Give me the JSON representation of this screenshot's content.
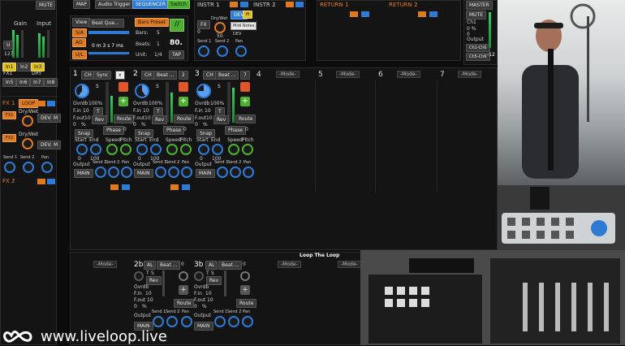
{
  "left": {
    "mute": "MUTE",
    "gain": "Gain",
    "input": "Input",
    "u": "U",
    "num127": "127",
    "inputs_row1": [
      "In1",
      "In2",
      "In3"
    ],
    "fx1": "FX1",
    "dry": "DRY",
    "inputs_row2": [
      "In5",
      "In6",
      "In7",
      "In8"
    ],
    "fx_section": "FX 1",
    "loop_badge": "LOOP",
    "dryw": "Dry/Wet",
    "dev": "DEV",
    "m": "M",
    "fx_section2": "FX 2",
    "send1": "Send 1",
    "send2": "Send 2",
    "pan": "Pan"
  },
  "top": {
    "tabs": [
      "MAP",
      "Audio Trigger",
      "SEQUENCER",
      "Switch"
    ],
    "view": "View",
    "beat_quant": "Beat Qua...",
    "bars_preset": "Bars Preset",
    "sa": "S/A",
    "ad": "AD",
    "ul": "U/L",
    "bars_label": "Bars:",
    "bars_val": "5",
    "beats_label": "Beats:",
    "beats_val": "1",
    "unit_label": "Unit:",
    "unit_val": "1/4",
    "time": "0 m 3 s 7 ms",
    "tempo": "80.",
    "tap": "TAP",
    "fx_glyph": "//"
  },
  "instr": {
    "instr1": "INSTR 1",
    "instr2": "INSTR 2",
    "dev": "DEV",
    "tooltip": "Midi Notes",
    "fx": "FX",
    "dry": "Dry/Wet",
    "dev2": "DEV",
    "fifty": "50",
    "zero": "0",
    "send1": "Send 1",
    "send2": "Send 2",
    "pan": "Pan"
  },
  "returns": {
    "r1": "RETURN 1",
    "r2": "RETURN 2"
  },
  "master": {
    "master": "MASTER",
    "mute": "MUTE",
    "ch": "Ch1",
    "pct": "0 %",
    "zero": "0",
    "output": "Output",
    "chout1": "Ch1-Ch6",
    "chout2": "Ch5-Ch6",
    "db": "-12"
  },
  "tracks": [
    {
      "num": "1",
      "ch": "CH",
      "name": "Sync",
      "x": "x"
    },
    {
      "num": "2",
      "ch": "CH",
      "name": "Beat ...",
      "x": "2"
    },
    {
      "num": "3",
      "ch": "CH",
      "name": "Beat ...",
      "x": "7"
    }
  ],
  "track_common": {
    "ovrdb": "Ovrdb",
    "pct100": "100%",
    "fin": "F.in",
    "fout": "F.out",
    "v10": "10",
    "v0": "0",
    "pct": "%",
    "t": "T",
    "rev": "Rev",
    "s": "S",
    "route": "Route",
    "snap": "Snap",
    "phase": "Phase",
    "start": "Start",
    "end": "End",
    "speed": "Speed",
    "pitch": "Pitch",
    "v100": "100",
    "output": "Output",
    "main": "MAIN",
    "send1": "Send 1",
    "send2": "Send 2",
    "pan": "Pan"
  },
  "empty_slots": [
    {
      "num": "4",
      "mode": "-Mode-"
    },
    {
      "num": "5",
      "mode": "-Mode-"
    },
    {
      "num": "6",
      "mode": "-Mode-"
    },
    {
      "num": "7",
      "mode": "-Mode-"
    }
  ],
  "bottom": {
    "title": "Loop The Loop",
    "mode": "-Mode-",
    "t2b": "2b",
    "t3b": "3b",
    "al": "AL",
    "beat": "Beat ...",
    "zero": "0"
  },
  "watermark": {
    "url": "www.liveloop.live"
  }
}
